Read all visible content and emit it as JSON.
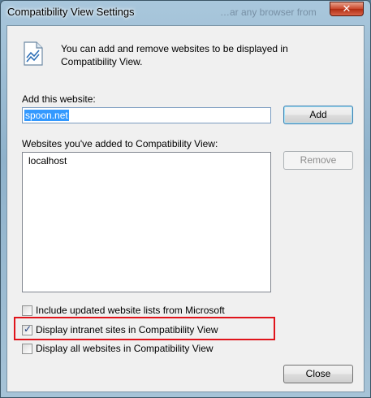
{
  "window": {
    "title": "Compatibility View Settings",
    "background_text": "…ar any browser from th…"
  },
  "intro": {
    "text": "You can add and remove websites to be displayed in Compatibility View."
  },
  "add_website": {
    "label": "Add this website:",
    "value": "spoon.net",
    "add_button": "Add"
  },
  "list": {
    "label": "Websites you've added to Compatibility View:",
    "items": [
      "localhost"
    ],
    "remove_button": "Remove"
  },
  "options": [
    {
      "label": "Include updated website lists from Microsoft",
      "checked": false
    },
    {
      "label": "Display intranet sites in Compatibility View",
      "checked": true
    },
    {
      "label": "Display all websites in Compatibility View",
      "checked": false
    }
  ],
  "footer": {
    "close_button": "Close"
  },
  "colors": {
    "highlight": "#e0141b",
    "selection": "#3399ff",
    "title_close": "#c9452a"
  }
}
